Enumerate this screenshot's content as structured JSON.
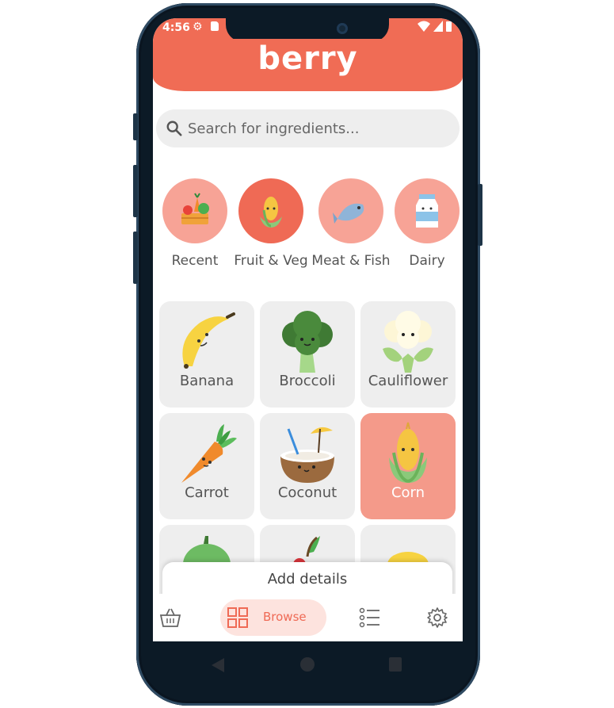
{
  "status_bar": {
    "time": "4:56",
    "icons": [
      "gear-icon",
      "sd-card-icon"
    ],
    "right_icons": [
      "wifi-icon",
      "signal-icon",
      "battery-icon"
    ]
  },
  "header": {
    "title": "berry"
  },
  "search": {
    "placeholder": "Search for ingredients..."
  },
  "categories": [
    {
      "label": "Recent",
      "icon": "vegetable-crate-icon",
      "active": false
    },
    {
      "label": "Fruit & Veg",
      "icon": "corn-icon",
      "active": true
    },
    {
      "label": "Meat & Fish",
      "icon": "fish-icon",
      "active": false
    },
    {
      "label": "Dairy",
      "icon": "milk-carton-icon",
      "active": false
    }
  ],
  "ingredients": [
    {
      "label": "Banana",
      "icon": "banana-icon",
      "selected": false
    },
    {
      "label": "Broccoli",
      "icon": "broccoli-icon",
      "selected": false
    },
    {
      "label": "Cauliflower",
      "icon": "cauliflower-icon",
      "selected": false
    },
    {
      "label": "Carrot",
      "icon": "carrot-icon",
      "selected": false
    },
    {
      "label": "Coconut",
      "icon": "coconut-icon",
      "selected": false
    },
    {
      "label": "Corn",
      "icon": "corn-icon",
      "selected": true
    },
    {
      "label": "",
      "icon": "pepper-icon",
      "selected": false
    },
    {
      "label": "",
      "icon": "cherry-icon",
      "selected": false
    },
    {
      "label": "",
      "icon": "lemon-icon",
      "selected": false
    }
  ],
  "sheet": {
    "label": "Add details"
  },
  "bottom_nav": {
    "items": [
      {
        "icon": "basket-icon",
        "label": ""
      },
      {
        "icon": "grid-icon",
        "label": "Browse"
      },
      {
        "icon": "list-icon",
        "label": ""
      },
      {
        "icon": "gear-icon",
        "label": ""
      }
    ]
  },
  "colors": {
    "brand": "#f06c55",
    "category_circle": "#f7a396",
    "selected_tile": "#f49a8a",
    "tile": "#eeeeee",
    "nav_active_bg": "#fde3de"
  }
}
